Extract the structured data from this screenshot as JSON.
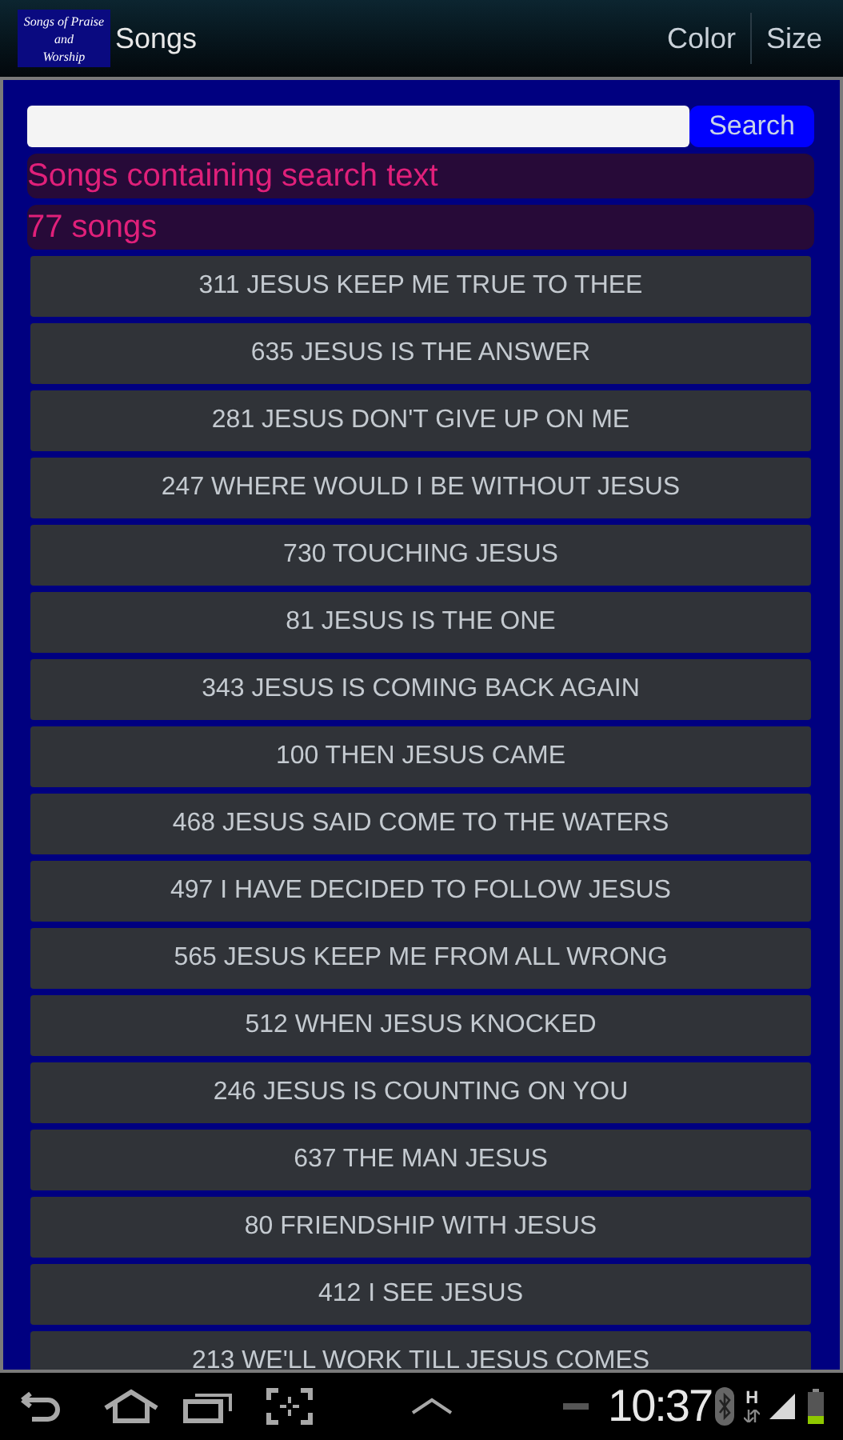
{
  "app_bar": {
    "logo_lines": [
      "Songs of Praise",
      "and",
      "Worship"
    ],
    "title": "Songs",
    "actions": [
      "Color",
      "Size"
    ]
  },
  "search": {
    "button": "Search"
  },
  "info": [
    "Songs containing search text",
    "77 songs"
  ],
  "songs": [
    "311 JESUS KEEP ME TRUE TO THEE",
    "635 JESUS IS THE ANSWER",
    "281 JESUS DON'T GIVE UP ON ME",
    "247 WHERE WOULD I BE WITHOUT JESUS",
    "730 TOUCHING JESUS",
    "81 JESUS IS THE ONE",
    "343 JESUS IS COMING BACK AGAIN",
    "100 THEN JESUS CAME",
    "468 JESUS SAID COME TO THE WATERS",
    "497 I HAVE DECIDED TO FOLLOW JESUS",
    "565 JESUS KEEP ME FROM ALL WRONG",
    "512 WHEN JESUS KNOCKED",
    "246 JESUS IS COUNTING ON YOU",
    "637 THE MAN JESUS",
    "80 FRIENDSHIP WITH JESUS",
    "412 I SEE JESUS",
    "213 WE'LL WORK TILL JESUS COMES"
  ],
  "system_bar": {
    "time": "10:37",
    "network": "H"
  }
}
